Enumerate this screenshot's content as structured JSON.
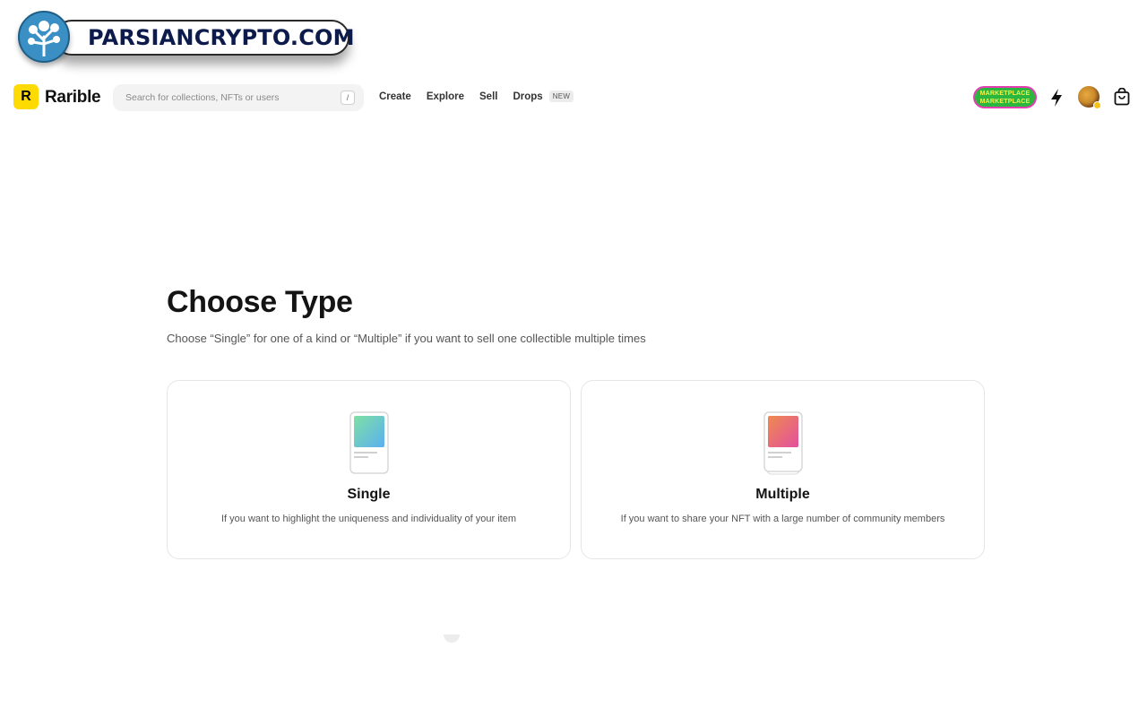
{
  "watermark": {
    "text": "PARSIANCRYPTO.COM"
  },
  "header": {
    "logo_letter": "R",
    "brand": "Rarible",
    "search_placeholder": "Search for collections, NFTs or users",
    "search_shortcut": "/",
    "nav": [
      {
        "label": "Create"
      },
      {
        "label": "Explore"
      },
      {
        "label": "Sell"
      },
      {
        "label": "Drops"
      }
    ],
    "drops_badge": "NEW",
    "marketplace_badge": {
      "line1": "MARKETPLACE",
      "line2": "MARKETPLACE"
    }
  },
  "main": {
    "title": "Choose Type",
    "subtitle": "Choose “Single” for one of a kind or “Multiple” if you want to sell one collectible multiple times",
    "cards": [
      {
        "title": "Single",
        "description": "If you want to highlight the uniqueness and individuality of your item"
      },
      {
        "title": "Multiple",
        "description": "If you want to share your NFT with a large number of community members"
      }
    ]
  },
  "colors": {
    "brand_yellow": "#feda03",
    "marketplace_green": "#2bb63f",
    "marketplace_border": "#e33fb3"
  }
}
